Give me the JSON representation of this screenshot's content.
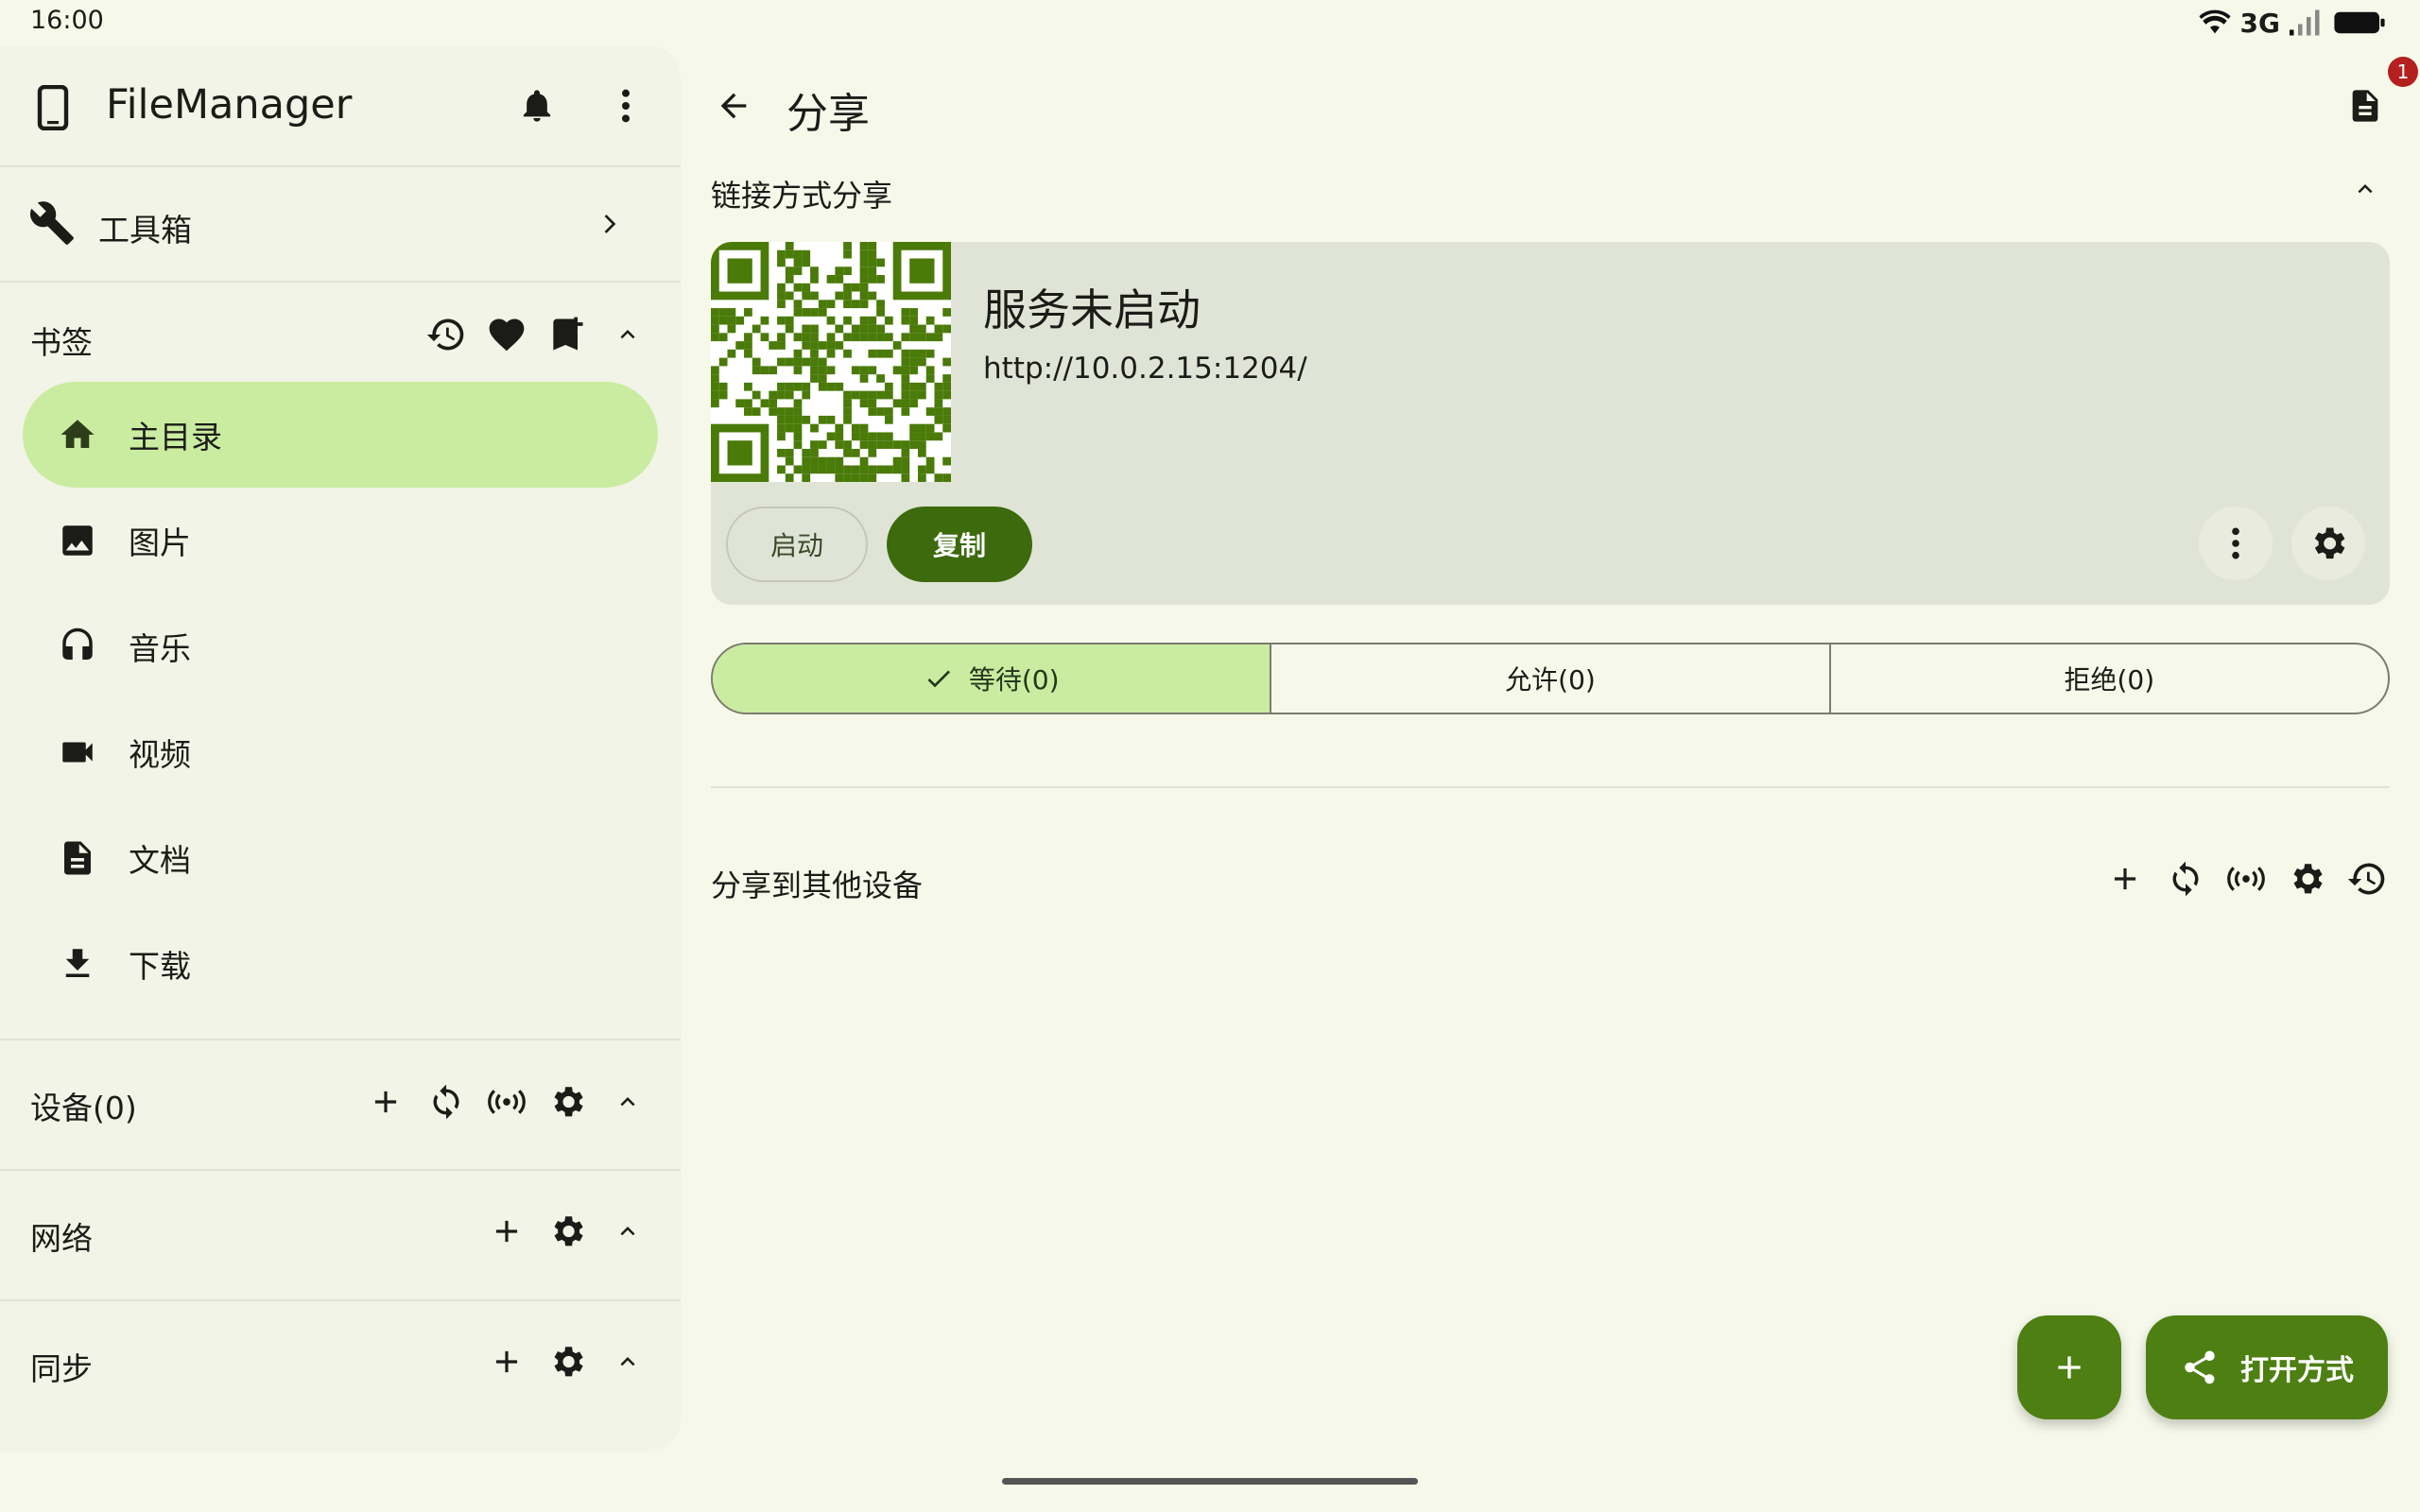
{
  "status_bar": {
    "time": "16:00",
    "network": "3G",
    "icons": [
      "wifi-icon",
      "signal-icon",
      "battery-icon"
    ]
  },
  "drawer": {
    "app_title": "FileManager",
    "toolbox_label": "工具箱",
    "bookmarks_label": "书签",
    "items": [
      {
        "label": "主目录",
        "icon": "home-icon",
        "active": true
      },
      {
        "label": "图片",
        "icon": "image-icon",
        "active": false
      },
      {
        "label": "音乐",
        "icon": "headphones-icon",
        "active": false
      },
      {
        "label": "视频",
        "icon": "video-icon",
        "active": false
      },
      {
        "label": "文档",
        "icon": "document-icon",
        "active": false
      },
      {
        "label": "下载",
        "icon": "download-icon",
        "active": false
      }
    ],
    "devices_label": "设备(0)",
    "network_label": "网络",
    "sync_label": "同步"
  },
  "main": {
    "title": "分享",
    "notification_badge": "1",
    "link_share_label": "链接方式分享",
    "card": {
      "status": "服务未启动",
      "url": "http://10.0.2.15:1204/",
      "start_label": "启动",
      "copy_label": "复制"
    },
    "tabs": [
      {
        "label": "等待(0)",
        "active": true
      },
      {
        "label": "允许(0)",
        "active": false
      },
      {
        "label": "拒绝(0)",
        "active": false
      }
    ],
    "share_other_label": "分享到其他设备",
    "fab_open_with_label": "打开方式"
  },
  "colors": {
    "accent": "#3c6a0c",
    "active_bg": "#caeca0",
    "background": "#f6f9ea",
    "drawer_bg": "#f1f4e6",
    "qr_color": "#4a7a08"
  }
}
